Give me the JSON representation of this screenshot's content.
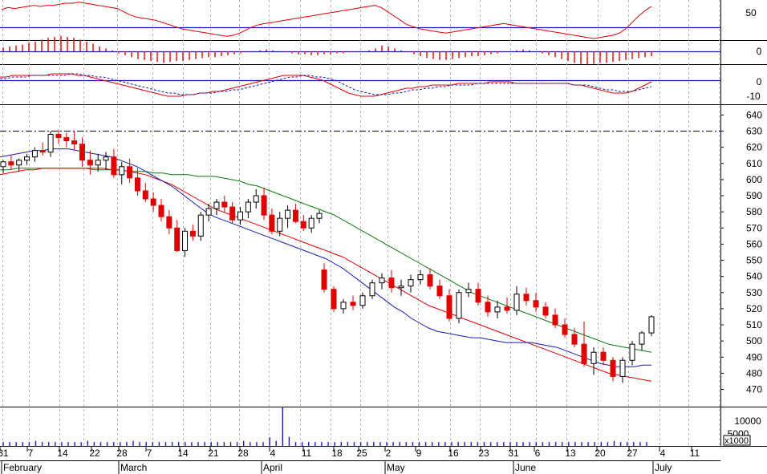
{
  "chart_data": {
    "type": "candlestick",
    "panels": {
      "rsi": {
        "ticks": [
          "50"
        ],
        "reference_level": 30,
        "values": [
          54,
          56,
          55,
          56,
          57,
          58,
          57,
          58,
          58,
          59,
          60,
          60,
          61,
          60,
          59,
          58,
          57,
          56,
          55,
          52,
          49,
          47,
          46,
          45,
          44,
          42,
          40,
          38,
          36,
          35,
          34,
          33,
          32,
          31,
          30,
          29,
          30,
          32,
          35,
          38,
          40,
          41,
          42,
          43,
          44,
          45,
          46,
          47,
          48,
          49,
          50,
          51,
          52,
          53,
          54,
          55,
          56,
          57,
          58,
          56,
          52,
          48,
          44,
          40,
          38,
          36,
          35,
          34,
          33,
          32,
          33,
          34,
          35,
          36,
          37,
          38,
          39,
          40,
          41,
          40,
          39,
          38,
          37,
          36,
          35,
          34,
          33,
          32,
          31,
          30,
          29,
          28,
          27,
          28,
          29,
          30,
          32,
          36,
          42,
          48,
          53,
          57
        ]
      },
      "histogram": {
        "ticks": [
          "0"
        ],
        "values": [
          0.4,
          0.5,
          0.6,
          0.7,
          0.9,
          1.0,
          1.2,
          1.4,
          1.5,
          1.6,
          1.5,
          1.4,
          1.2,
          1.0,
          0.8,
          0.5,
          0.3,
          0.1,
          -0.2,
          -0.4,
          -0.6,
          -0.8,
          -0.9,
          -1.0,
          -1.1,
          -1.2,
          -1.1,
          -1.0,
          -1.0,
          -0.9,
          -0.8,
          -0.7,
          -0.6,
          -0.6,
          -0.5,
          -0.4,
          -0.3,
          -0.2,
          -0.1,
          0.0,
          0.1,
          0.2,
          0.1,
          0.0,
          -0.1,
          -0.2,
          -0.3,
          -0.3,
          -0.4,
          -0.4,
          -0.3,
          -0.3,
          -0.2,
          -0.2,
          -0.1,
          -0.1,
          0.0,
          0.1,
          0.3,
          0.6,
          0.5,
          0.3,
          0.1,
          -0.1,
          -0.3,
          -0.5,
          -0.7,
          -0.8,
          -0.9,
          -0.9,
          -0.8,
          -0.7,
          -0.6,
          -0.5,
          -0.5,
          -0.4,
          -0.3,
          -0.2,
          -0.1,
          0.0,
          0.1,
          0.2,
          0.1,
          0.0,
          -0.2,
          -0.4,
          -0.6,
          -0.8,
          -1.0,
          -1.2,
          -1.3,
          -1.4,
          -1.3,
          -1.2,
          -1.2,
          -1.1,
          -1.0,
          -0.9,
          -0.8,
          -0.7,
          -0.6,
          -0.5
        ]
      },
      "macd": {
        "ticks": [
          "0",
          "-10"
        ],
        "macd": [
          2,
          2,
          3,
          3,
          3,
          3,
          3,
          3,
          4,
          4,
          4,
          4,
          3,
          3,
          2,
          1,
          0,
          -1,
          -2,
          -3,
          -4,
          -5,
          -6,
          -7,
          -8,
          -9,
          -10,
          -10,
          -10,
          -9,
          -9,
          -8,
          -8,
          -7,
          -7,
          -6,
          -5,
          -4,
          -3,
          -2,
          -1,
          0,
          1,
          2,
          3,
          3,
          3,
          3,
          2,
          1,
          0,
          -2,
          -4,
          -6,
          -8,
          -9,
          -10,
          -10,
          -10,
          -9,
          -8,
          -7,
          -6,
          -5,
          -5,
          -4,
          -4,
          -3,
          -3,
          -3,
          -3,
          -2,
          -2,
          -2,
          -2,
          -2,
          -1,
          -1,
          -1,
          -1,
          -2,
          -2,
          -2,
          -2,
          -2,
          -2,
          -2,
          -2,
          -2,
          -3,
          -3,
          -4,
          -5,
          -6,
          -7,
          -8,
          -8,
          -8,
          -7,
          -5,
          -3,
          -1
        ],
        "signal": [
          1,
          1,
          2,
          2,
          2,
          3,
          3,
          3,
          3,
          3,
          3,
          4,
          4,
          3,
          3,
          2,
          2,
          1,
          0,
          -1,
          -2,
          -3,
          -4,
          -5,
          -6,
          -7,
          -8,
          -8,
          -9,
          -9,
          -9,
          -8,
          -8,
          -8,
          -7,
          -7,
          -6,
          -6,
          -5,
          -4,
          -3,
          -2,
          -1,
          0,
          1,
          2,
          2,
          3,
          3,
          2,
          2,
          1,
          0,
          -2,
          -4,
          -6,
          -7,
          -8,
          -9,
          -9,
          -9,
          -8,
          -8,
          -7,
          -6,
          -6,
          -5,
          -5,
          -4,
          -4,
          -3,
          -3,
          -3,
          -3,
          -2,
          -2,
          -2,
          -2,
          -2,
          -2,
          -2,
          -2,
          -2,
          -2,
          -2,
          -2,
          -2,
          -2,
          -2,
          -3,
          -3,
          -3,
          -4,
          -5,
          -6,
          -6,
          -7,
          -7,
          -7,
          -6,
          -5,
          -4
        ]
      },
      "price": {
        "ticks": [
          640,
          630,
          620,
          610,
          600,
          590,
          580,
          570,
          560,
          550,
          540,
          530,
          520,
          510,
          500,
          490,
          480,
          470
        ],
        "reference_level": 630,
        "candles": [
          [
            608,
            612,
            604,
            611
          ],
          [
            611,
            615,
            606,
            609
          ],
          [
            609,
            613,
            605,
            612
          ],
          [
            612,
            616,
            609,
            614
          ],
          [
            614,
            620,
            611,
            618
          ],
          [
            618,
            623,
            615,
            617
          ],
          [
            617,
            630,
            614,
            628
          ],
          [
            628,
            631,
            622,
            626
          ],
          [
            626,
            629,
            620,
            624
          ],
          [
            624,
            630,
            618,
            622
          ],
          [
            622,
            626,
            608,
            612
          ],
          [
            612,
            618,
            603,
            609
          ],
          [
            609,
            616,
            605,
            612
          ],
          [
            612,
            617,
            606,
            614
          ],
          [
            614,
            619,
            601,
            603
          ],
          [
            603,
            611,
            597,
            608
          ],
          [
            608,
            613,
            598,
            601
          ],
          [
            601,
            607,
            590,
            593
          ],
          [
            593,
            598,
            586,
            588
          ],
          [
            588,
            592,
            580,
            584
          ],
          [
            584,
            588,
            574,
            577
          ],
          [
            577,
            581,
            566,
            570
          ],
          [
            570,
            575,
            555,
            556
          ],
          [
            556,
            570,
            552,
            568
          ],
          [
            568,
            572,
            562,
            565
          ],
          [
            565,
            580,
            562,
            578
          ],
          [
            578,
            585,
            574,
            582
          ],
          [
            582,
            588,
            578,
            586
          ],
          [
            586,
            590,
            580,
            583
          ],
          [
            583,
            586,
            573,
            575
          ],
          [
            575,
            583,
            572,
            580
          ],
          [
            580,
            588,
            576,
            586
          ],
          [
            586,
            594,
            582,
            590
          ],
          [
            590,
            595,
            575,
            578
          ],
          [
            578,
            582,
            566,
            568
          ],
          [
            568,
            580,
            565,
            576
          ],
          [
            576,
            584,
            570,
            581
          ],
          [
            581,
            585,
            573,
            574
          ],
          [
            574,
            578,
            568,
            570
          ],
          [
            570,
            578,
            567,
            576
          ],
          [
            576,
            581,
            573,
            579
          ],
          [
            544,
            548,
            530,
            532
          ],
          [
            532,
            534,
            518,
            520
          ],
          [
            520,
            526,
            517,
            524
          ],
          [
            524,
            528,
            519,
            522
          ],
          [
            522,
            530,
            520,
            528
          ],
          [
            528,
            538,
            526,
            536
          ],
          [
            536,
            542,
            532,
            539
          ],
          [
            539,
            544,
            530,
            533
          ],
          [
            533,
            538,
            528,
            534
          ],
          [
            534,
            541,
            530,
            538
          ],
          [
            538,
            544,
            535,
            541
          ],
          [
            541,
            545,
            532,
            534
          ],
          [
            534,
            538,
            526,
            528
          ],
          [
            528,
            532,
            512,
            514
          ],
          [
            514,
            532,
            511,
            530
          ],
          [
            530,
            536,
            527,
            532
          ],
          [
            532,
            536,
            522,
            524
          ],
          [
            524,
            528,
            515,
            518
          ],
          [
            518,
            525,
            514,
            521
          ],
          [
            521,
            527,
            517,
            519
          ],
          [
            519,
            534,
            516,
            529
          ],
          [
            529,
            533,
            522,
            525
          ],
          [
            525,
            530,
            518,
            521
          ],
          [
            521,
            524,
            514,
            516
          ],
          [
            516,
            520,
            508,
            510
          ],
          [
            510,
            514,
            502,
            504
          ],
          [
            504,
            508,
            496,
            498
          ],
          [
            498,
            512,
            484,
            486
          ],
          [
            486,
            496,
            479,
            493
          ],
          [
            493,
            496,
            485,
            488
          ],
          [
            488,
            490,
            475,
            478
          ],
          [
            478,
            490,
            474,
            488
          ],
          [
            488,
            500,
            485,
            498
          ],
          [
            498,
            506,
            494,
            505
          ],
          [
            505,
            516,
            503,
            515
          ]
        ],
        "ma_short": [
          614,
          615,
          616,
          617,
          618,
          618,
          619,
          619,
          619,
          618,
          617,
          616,
          615,
          614,
          612,
          610,
          608,
          605,
          602,
          599,
          596,
          592,
          588,
          584,
          580,
          577,
          575,
          573,
          571,
          569,
          567,
          565,
          563,
          561,
          559,
          557,
          555,
          553,
          551,
          548,
          545,
          541,
          537,
          533,
          529,
          525,
          521,
          518,
          514,
          511,
          508,
          506,
          505,
          504,
          503,
          502,
          502,
          501,
          500,
          499,
          499,
          499,
          499,
          498,
          497,
          496,
          494,
          492,
          490,
          488,
          486,
          485,
          484,
          484,
          484,
          485,
          485
        ],
        "ma_mid": [
          603,
          604,
          605,
          606,
          606,
          607,
          607,
          607,
          607,
          607,
          607,
          607,
          607,
          606,
          606,
          605,
          604,
          603,
          601,
          599,
          597,
          594,
          591,
          588,
          585,
          582,
          580,
          578,
          576,
          574,
          572,
          570,
          568,
          566,
          564,
          562,
          560,
          558,
          556,
          554,
          552,
          549,
          546,
          543,
          540,
          537,
          534,
          531,
          528,
          525,
          522,
          520,
          518,
          516,
          514,
          512,
          510,
          508,
          506,
          504,
          502,
          500,
          498,
          496,
          494,
          492,
          490,
          488,
          486,
          484,
          482,
          480,
          479,
          478,
          477,
          476,
          475
        ],
        "ma_long": [
          606,
          606,
          607,
          607,
          607,
          607,
          607,
          607,
          607,
          607,
          607,
          606,
          606,
          606,
          606,
          605,
          605,
          605,
          604,
          604,
          603,
          603,
          603,
          602,
          602,
          602,
          601,
          600,
          599,
          597,
          596,
          594,
          592,
          590,
          588,
          586,
          584,
          582,
          580,
          578,
          575,
          572,
          569,
          566,
          563,
          560,
          557,
          554,
          551,
          548,
          545,
          542,
          539,
          536,
          533,
          530,
          528,
          526,
          524,
          522,
          520,
          518,
          516,
          514,
          512,
          510,
          508,
          506,
          504,
          502,
          500,
          498,
          497,
          496,
          495,
          494,
          493
        ]
      },
      "volume": {
        "ticks": [
          "10000",
          "5000"
        ],
        "unit_label": "x1000",
        "values": [
          3,
          3,
          3,
          3,
          3,
          4,
          3,
          3,
          3,
          3,
          3,
          3,
          3,
          4,
          3,
          3,
          3,
          3,
          3,
          3,
          4,
          3,
          3,
          3,
          3,
          3,
          3,
          3,
          3,
          3,
          3,
          3,
          3,
          3,
          3,
          3,
          3,
          4,
          3,
          3,
          3,
          3,
          4,
          4,
          7,
          3,
          3,
          3,
          3,
          3,
          3,
          3,
          3,
          3,
          3,
          3,
          3,
          3,
          3,
          3,
          3,
          3,
          3,
          3,
          3,
          3,
          3,
          3,
          3,
          3,
          3,
          3,
          3,
          3,
          3,
          3,
          3,
          3,
          3,
          3,
          3,
          3,
          3,
          3,
          3,
          3,
          3,
          3,
          3,
          3,
          3,
          3,
          3,
          3,
          4,
          3,
          3,
          3,
          3,
          3
        ]
      }
    },
    "x_axis": {
      "day_labels": [
        "31",
        "7",
        "14",
        "22",
        "28",
        "7",
        "14",
        "21",
        "28",
        "4",
        "11",
        "18",
        "25",
        "2",
        "9",
        "16",
        "23",
        "31",
        "6",
        "13",
        "20",
        "27",
        "4",
        "11"
      ],
      "month_labels": [
        "February",
        "March",
        "April",
        "May",
        "June",
        "July"
      ]
    }
  }
}
